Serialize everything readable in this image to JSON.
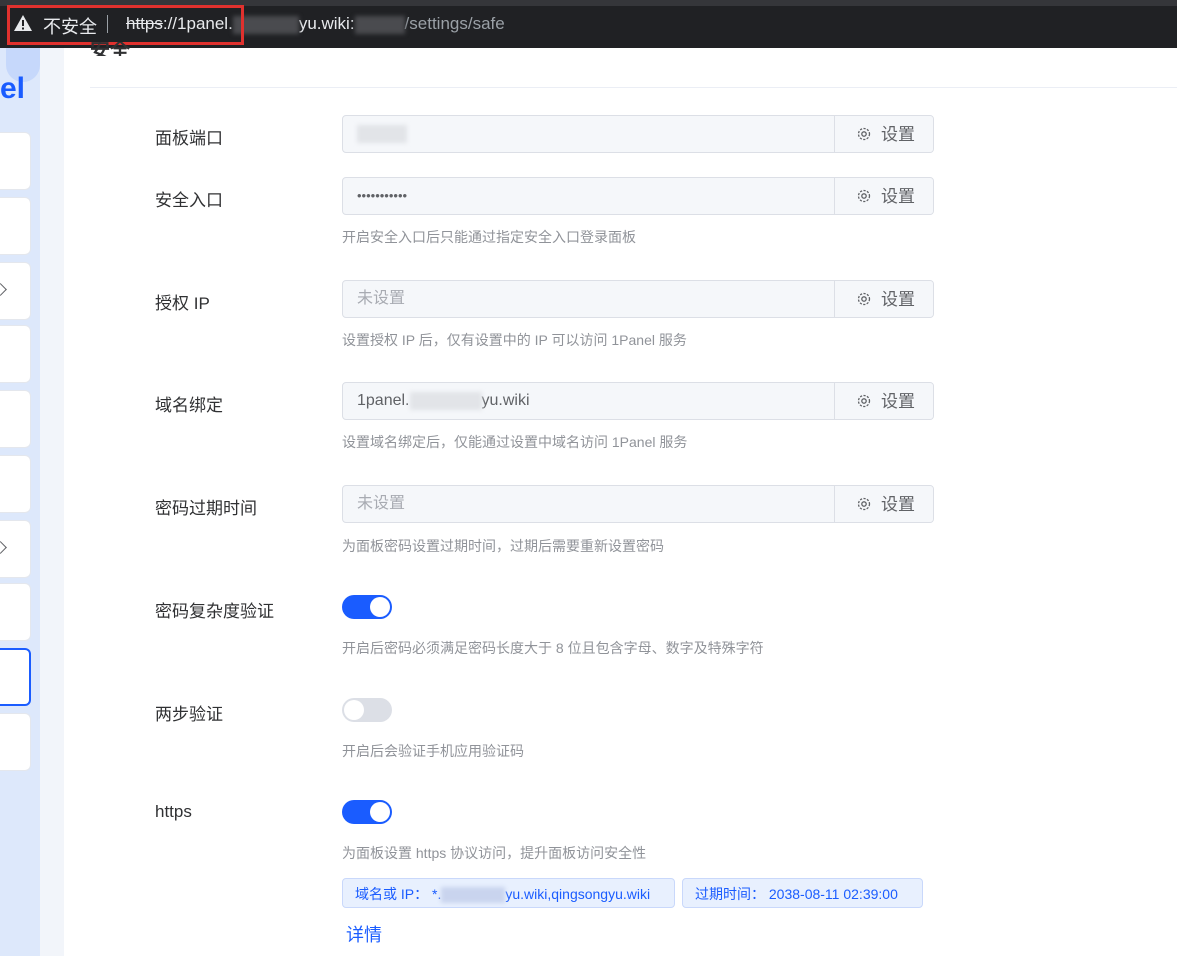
{
  "browser": {
    "insecure_label": "不安全",
    "url_scheme": "https",
    "url_prefix": "://1panel.",
    "url_mid": "yu.wiki:",
    "url_path": "/settings/safe"
  },
  "sidebar": {
    "logo_fragment": "el"
  },
  "page": {
    "title": "安全"
  },
  "settings": {
    "panel_port": {
      "label": "面板端口",
      "button": "设置"
    },
    "security_entrance": {
      "label": "安全入口",
      "value": "•••••••••••",
      "button": "设置",
      "help": "开启安全入口后只能通过指定安全入口登录面板"
    },
    "allowed_ip": {
      "label": "授权 IP",
      "placeholder": "未设置",
      "button": "设置",
      "help": "设置授权 IP 后，仅有设置中的 IP 可以访问 1Panel 服务"
    },
    "domain_binding": {
      "label": "域名绑定",
      "value_prefix": "1panel.",
      "value_suffix": "yu.wiki",
      "button": "设置",
      "help": "设置域名绑定后，仅能通过设置中域名访问 1Panel 服务"
    },
    "password_expiry": {
      "label": "密码过期时间",
      "placeholder": "未设置",
      "button": "设置",
      "help": "为面板密码设置过期时间，过期后需要重新设置密码"
    },
    "password_complexity": {
      "label": "密码复杂度验证",
      "enabled": true,
      "help": "开启后密码必须满足密码长度大于 8 位且包含字母、数字及特殊字符"
    },
    "two_factor": {
      "label": "两步验证",
      "enabled": false,
      "help": "开启后会验证手机应用验证码"
    },
    "https": {
      "label": "https",
      "enabled": true,
      "help": "为面板设置 https 协议访问，提升面板访问安全性",
      "domain_tag_prefix": "域名或 IP：  *.",
      "domain_tag_suffix": "yu.wiki,qingsongyu.wiki",
      "expiry_tag": "过期时间：  2038-08-11 02:39:00",
      "details_link": "详情"
    }
  },
  "colors": {
    "accent": "#1a5cff",
    "highlight_box": "#e0312e",
    "topbar": "#202124"
  }
}
